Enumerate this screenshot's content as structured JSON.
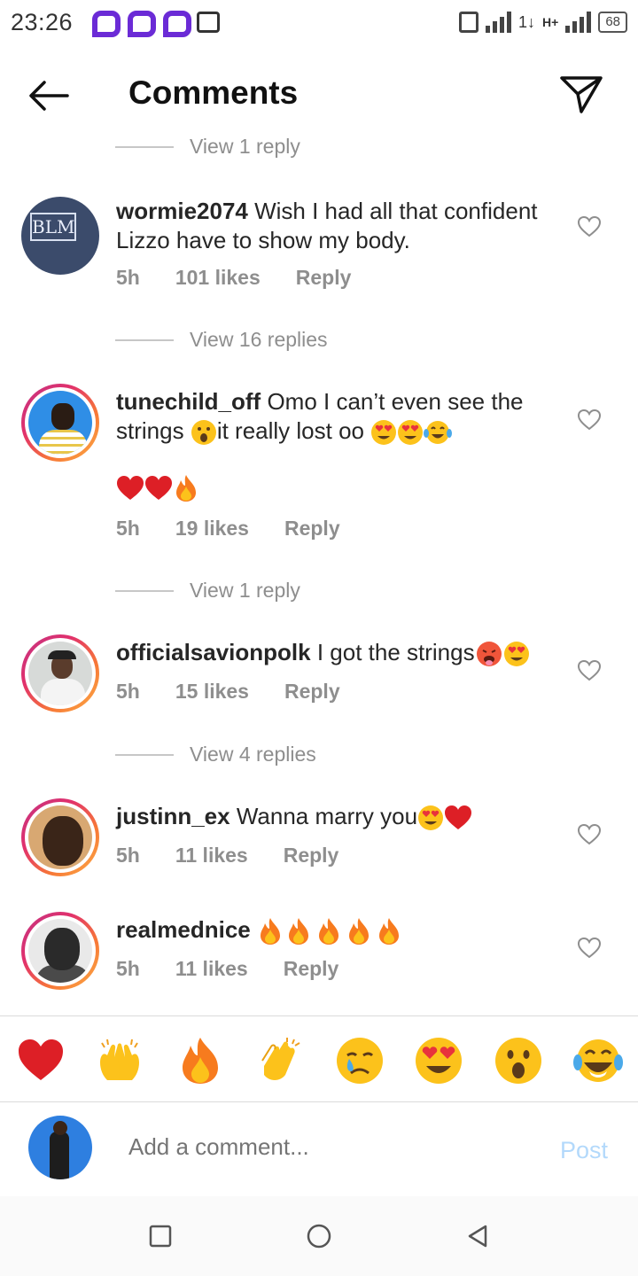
{
  "status_bar": {
    "time": "23:26",
    "battery": "68",
    "network": "H+",
    "data_arrows": "1↓"
  },
  "header": {
    "title": "Comments",
    "back_icon": "arrow-left-icon",
    "share_icon": "paper-plane-icon"
  },
  "replies_links": [
    "View 1 reply",
    "View 16 replies",
    "View 1 reply",
    "View 4 replies"
  ],
  "comments": [
    {
      "username": "wormie2074",
      "text": " Wish I had all that confident Lizzo have to show my body.",
      "time": "5h",
      "likes": "101 likes",
      "reply": "Reply",
      "avatar_text": "BLM"
    },
    {
      "username": "tunechild_off",
      "text": " Omo I can’t even see the strings ",
      "text2": "it really lost oo ",
      "line2": "",
      "time": "5h",
      "likes": "19 likes",
      "reply": "Reply"
    },
    {
      "username": "officialsavionpolk",
      "text": " I got the strings",
      "time": "5h",
      "likes": "15 likes",
      "reply": "Reply"
    },
    {
      "username": "justinn_ex",
      "text": " Wanna marry you",
      "time": "5h",
      "likes": "11 likes",
      "reply": "Reply"
    },
    {
      "username": "realmednice",
      "text": " ",
      "time": "5h",
      "likes": "11 likes",
      "reply": "Reply"
    }
  ],
  "reactions": [
    "red-heart",
    "raising-hands",
    "fire",
    "clapping-hands",
    "crying-face",
    "heart-eyes-face",
    "surprised-face",
    "tears-of-joy-face"
  ],
  "composer": {
    "placeholder": "Add a comment...",
    "post_label": "Post"
  },
  "colors": {
    "username": "#262626",
    "meta": "#8e8e8e",
    "post_disabled": "#b3d9fb",
    "story_ring": "#e1306c"
  }
}
